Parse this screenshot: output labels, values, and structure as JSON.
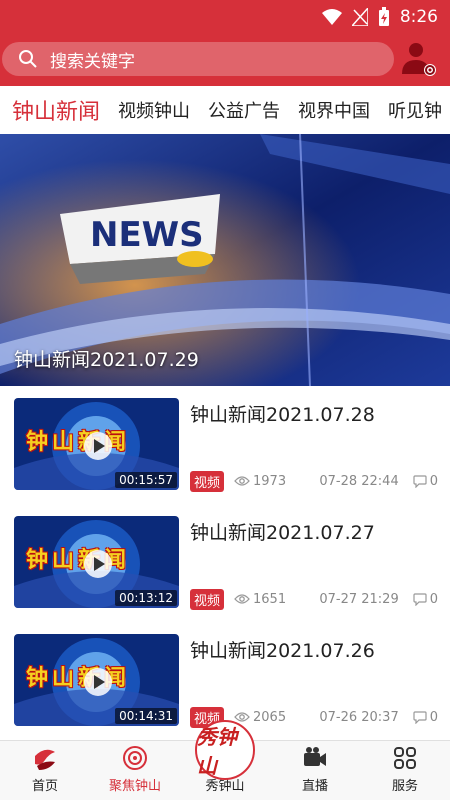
{
  "status": {
    "time": "8:26"
  },
  "search": {
    "placeholder": "搜索关键字"
  },
  "tabs": [
    {
      "label": "钟山新闻",
      "active": true
    },
    {
      "label": "视频钟山"
    },
    {
      "label": "公益广告"
    },
    {
      "label": "视界中国"
    },
    {
      "label": "听见钟"
    }
  ],
  "hero": {
    "caption": "钟山新闻2021.07.29"
  },
  "news": [
    {
      "title": "钟山新闻2021.07.28",
      "thumb_text": "钟山新闻",
      "duration": "00:15:57",
      "badge": "视频",
      "views": "1973",
      "date": "07-28 22:44",
      "comments": "0"
    },
    {
      "title": "钟山新闻2021.07.27",
      "thumb_text": "钟山新闻",
      "duration": "00:13:12",
      "badge": "视频",
      "views": "1651",
      "date": "07-27 21:29",
      "comments": "0"
    },
    {
      "title": "钟山新闻2021.07.26",
      "thumb_text": "钟山新闻",
      "duration": "00:14:31",
      "badge": "视频",
      "views": "2065",
      "date": "07-26 20:37",
      "comments": "0"
    }
  ],
  "bottom_nav": [
    {
      "label": "首页"
    },
    {
      "label": "聚焦钟山",
      "active": true
    },
    {
      "label": "秀钟山"
    },
    {
      "label": "直播"
    },
    {
      "label": "服务"
    }
  ],
  "center_logo": {
    "text": "秀钟山"
  },
  "colors": {
    "accent": "#d6303a"
  }
}
